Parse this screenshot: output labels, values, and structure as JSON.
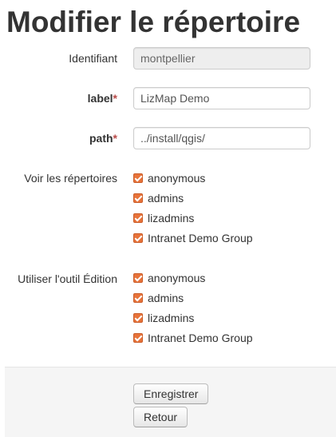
{
  "page": {
    "title": "Modifier le répertoire"
  },
  "form": {
    "identifiant": {
      "label": "Identifiant",
      "value": "montpellier"
    },
    "label_field": {
      "label": "label",
      "required_mark": "*",
      "value": "LizMap Demo"
    },
    "path_field": {
      "label": "path",
      "required_mark": "*",
      "value": "../install/qgis/"
    },
    "voir": {
      "label": "Voir les répertoires",
      "options": [
        {
          "label": "anonymous",
          "checked": true
        },
        {
          "label": "admins",
          "checked": true
        },
        {
          "label": "lizadmins",
          "checked": true
        },
        {
          "label": "Intranet Demo Group",
          "checked": true
        }
      ]
    },
    "edition": {
      "label": "Utiliser l'outil Édition",
      "options": [
        {
          "label": "anonymous",
          "checked": true
        },
        {
          "label": "admins",
          "checked": true
        },
        {
          "label": "lizadmins",
          "checked": true
        },
        {
          "label": "Intranet Demo Group",
          "checked": true
        }
      ]
    }
  },
  "actions": {
    "save_label": "Enregistrer",
    "back_label": "Retour"
  },
  "colors": {
    "checkbox": "#e8733a",
    "required": "#b94a48",
    "actions_bg": "#f5f5f5"
  }
}
